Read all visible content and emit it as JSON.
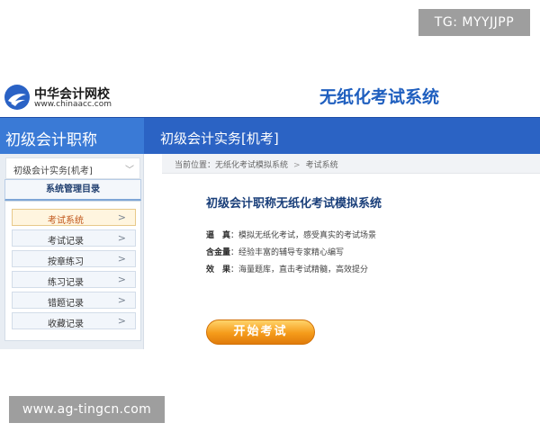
{
  "badge": {
    "tg": "TG: MYYJJPP"
  },
  "header": {
    "logo_cn": "中华会计网校",
    "logo_url": "www.chinaacc.com",
    "system_title": "无纸化考试系统",
    "logo_color": "#1f5fbf"
  },
  "banner": {
    "left_title": "初级会计职称",
    "right_title": "初级会计实务[机考]",
    "color": "#2b63c4"
  },
  "sidebar": {
    "course_select": "初级会计实务[机考]",
    "menu_title": "系统管理目录",
    "items": [
      {
        "label": "考试系统",
        "active": true
      },
      {
        "label": "考试记录",
        "active": false
      },
      {
        "label": "按章练习",
        "active": false
      },
      {
        "label": "练习记录",
        "active": false
      },
      {
        "label": "错题记录",
        "active": false
      },
      {
        "label": "收藏记录",
        "active": false
      }
    ],
    "arrow": ">"
  },
  "breadcrumb": {
    "prefix": "当前位置：无纸化考试模拟系统",
    "separator": ">",
    "current": "考试系统"
  },
  "main": {
    "title": "初级会计职称无纸化考试模拟系统",
    "features": [
      {
        "key": "逼　真",
        "desc": "：模拟无纸化考试，感受真实的考试场景"
      },
      {
        "key": "含金量",
        "desc": "：经验丰富的辅导专家精心编写"
      },
      {
        "key": "效　果",
        "desc": "：海量题库，直击考试精髓，高效提分"
      }
    ],
    "start_button": "开始考试",
    "button_color": "#f59b1a"
  },
  "watermark": {
    "text": "www.ag-tingcn.com"
  }
}
